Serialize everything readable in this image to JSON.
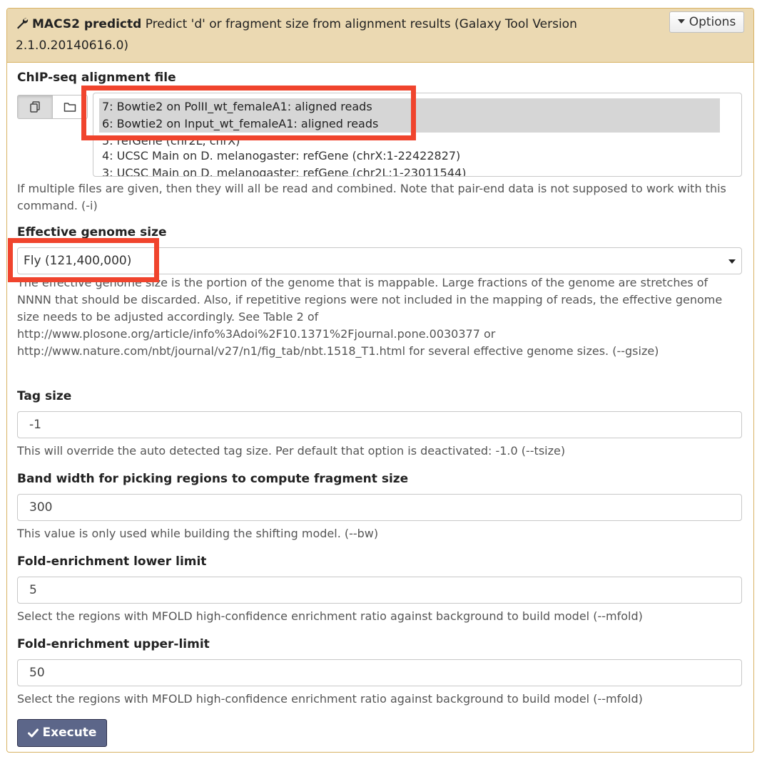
{
  "header": {
    "tool_name": "MACS2 predictd",
    "description": "Predict 'd' or fragment size from alignment results (Galaxy Tool Version 2.1.0.20140616.0)",
    "options_label": "Options",
    "icon": "wrench-icon"
  },
  "chip_seq": {
    "label": "ChIP-seq alignment file",
    "items": [
      {
        "text": "7: Bowtie2 on PolII_wt_femaleA1: aligned reads",
        "selected": true
      },
      {
        "text": "6: Bowtie2 on Input_wt_femaleA1: aligned reads",
        "selected": true
      },
      {
        "text": "5: refGene (chr2L, chrX)",
        "selected": false
      },
      {
        "text": "4: UCSC Main on D. melanogaster: refGene (chrX:1-22422827)",
        "selected": false
      },
      {
        "text": "3: UCSC Main on D. melanogaster: refGene (chr2L:1-23011544)",
        "selected": false
      }
    ],
    "help": "If multiple files are given, then they will all be read and combined. Note that pair-end data is not supposed to work with this command. (-i)"
  },
  "genome_size": {
    "label": "Effective genome size",
    "selected": "Fly (121,400,000)",
    "help": "The effective genome size is the portion of the genome that is mappable. Large fractions of the genome are stretches of NNNN that should be discarded. Also, if repetitive regions were not included in the mapping of reads, the effective genome size needs to be adjusted accordingly. See Table 2 of http://www.plosone.org/article/info%3Adoi%2F10.1371%2Fjournal.pone.0030377 or http://www.nature.com/nbt/journal/v27/n1/fig_tab/nbt.1518_T1.html for several effective genome sizes. (--gsize)"
  },
  "tag_size": {
    "label": "Tag size",
    "value": "-1",
    "help": "This will override the auto detected tag size. Per default that option is deactivated: -1.0 (--tsize)"
  },
  "band_width": {
    "label": "Band width for picking regions to compute fragment size",
    "value": "300",
    "help": "This value is only used while building the shifting model. (--bw)"
  },
  "fold_lower": {
    "label": "Fold-enrichment lower limit",
    "value": "5",
    "help": "Select the regions with MFOLD high-confidence enrichment ratio against background to build model (--mfold)"
  },
  "fold_upper": {
    "label": "Fold-enrichment upper-limit",
    "value": "50",
    "help": "Select the regions with MFOLD high-confidence enrichment ratio against background to build model (--mfold)"
  },
  "execute_label": "Execute",
  "colors": {
    "header_bg": "#ebd9b2",
    "panel_border": "#d8b365",
    "highlight": "#f0442d",
    "execute_bg": "#5c6689"
  }
}
